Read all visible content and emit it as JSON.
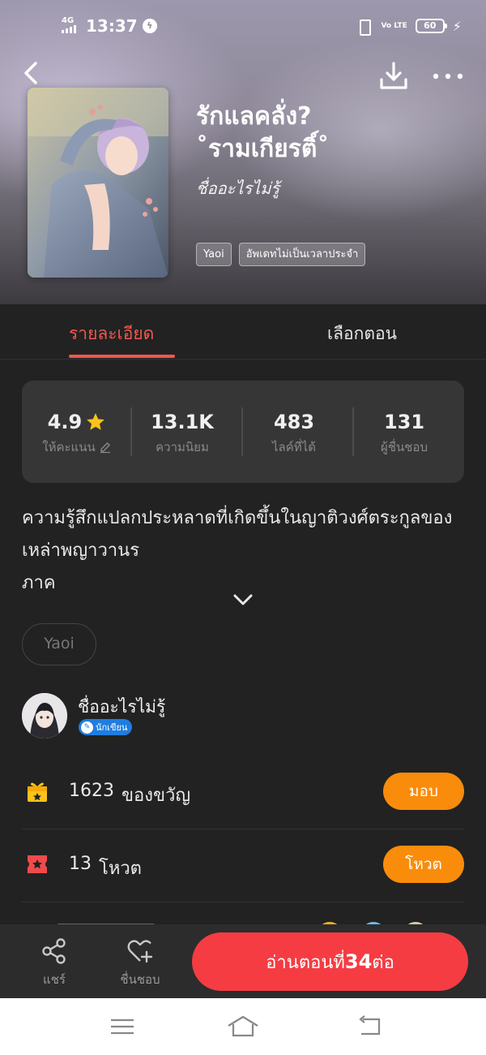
{
  "status_bar": {
    "network": "4G",
    "time": "13:37",
    "volte": "Vo LTE",
    "battery": "60",
    "icons": [
      "signal-icon",
      "messenger-icon",
      "vibrate-icon",
      "battery-icon",
      "charging-icon"
    ]
  },
  "header": {
    "title_line1": "รักแลคลั่ง?",
    "title_line2": "˚รามเกียรติ์˚",
    "author": "ชื่ออะไรไม่รู้",
    "tags": [
      "Yaoi",
      "อัพเดทไม่เป็นเวลาประจำ"
    ],
    "icons": [
      "back-arrow-icon",
      "download-icon",
      "more-icon"
    ]
  },
  "tabs": [
    {
      "label": "รายละเอียด",
      "active": true
    },
    {
      "label": "เลือกตอน",
      "active": false
    }
  ],
  "stats": [
    {
      "value": "4.9",
      "label": "ให้คะแนน"
    },
    {
      "value": "13.1K",
      "label": "ความนิยม"
    },
    {
      "value": "483",
      "label": "ไลค์ที่ได้"
    },
    {
      "value": "131",
      "label": "ผู้ชื่นชอบ"
    }
  ],
  "description": {
    "lines": [
      "ความรู้สึกแปลกประหลาดที่เกิดขึ้นในญาติวงศ์ตระกูลของ",
      "เหล่าพญาวานร",
      "ภาค"
    ]
  },
  "genre_chip": "Yaoi",
  "author_block": {
    "name": "ชื่ออะไรไม่รู้",
    "badge": "นักเขียน"
  },
  "actions": {
    "gift": {
      "count": "1623",
      "label": "ของขวัญ",
      "button": "มอบ"
    },
    "vote": {
      "count": "13",
      "label": "โหวต",
      "button": "โหวต"
    }
  },
  "bottom_bar": {
    "share_label": "แชร์",
    "favorite_label": "ชื่นชอบ",
    "read_prefix": "อ่านตอนที่",
    "read_number": "34",
    "read_suffix": "ต่อ"
  },
  "colors": {
    "accent_red": "#f1574f",
    "read_button": "#f53c43",
    "action_orange": "#fa8c0b",
    "writer_badge": "#1f7de0",
    "star": "#ffc21a"
  }
}
